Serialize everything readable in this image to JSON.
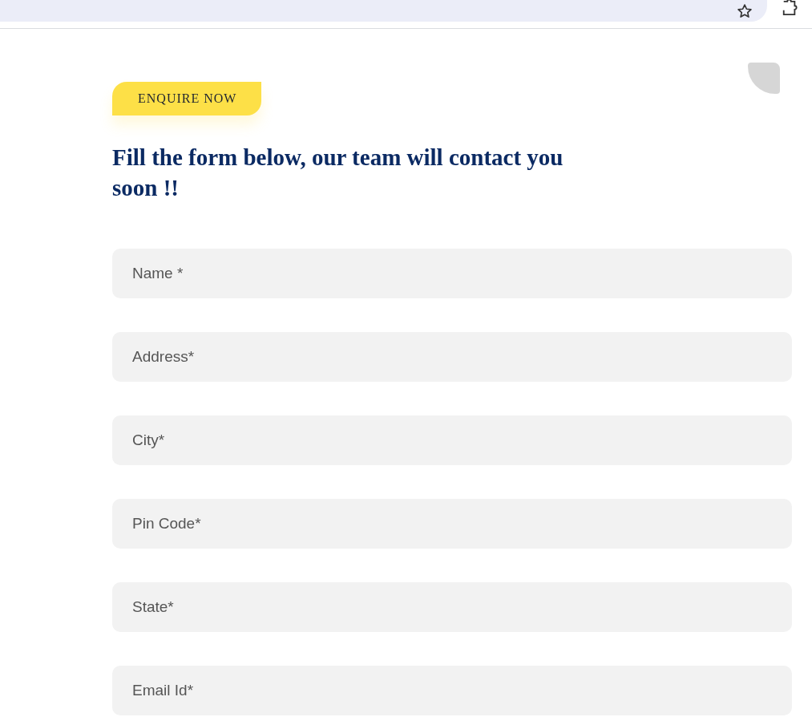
{
  "badge": "ENQUIRE NOW",
  "heading": "Fill the form below, our team will contact you soon !!",
  "fields": [
    {
      "placeholder": "Name *"
    },
    {
      "placeholder": "Address*"
    },
    {
      "placeholder": "City*"
    },
    {
      "placeholder": "Pin Code*"
    },
    {
      "placeholder": "State*"
    },
    {
      "placeholder": "Email Id*"
    }
  ]
}
